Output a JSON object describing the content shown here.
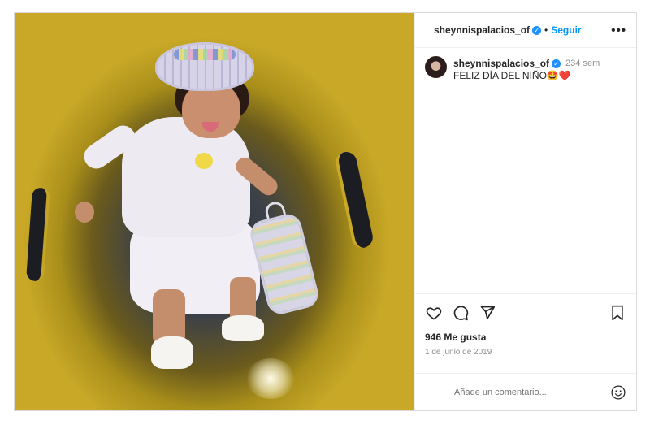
{
  "post": {
    "username": "sheynnispalacios_of",
    "follow_label": "Seguir",
    "dot_separator": "•",
    "more_label": "•••",
    "caption_username": "sheynnispalacios_of",
    "caption_age": "234 sem",
    "caption_text": "FELIZ DÍA DEL NIÑO🤩❤️",
    "likes": "946 Me gusta",
    "date": "1 de junio de 2019",
    "comment_placeholder": "Añade un comentario...",
    "verified_mark": "✓"
  },
  "colors": {
    "follow_blue": "#0095f6",
    "verified_blue": "#1e90ff",
    "muted_text": "#8e8e8e",
    "border": "#dbdbdb"
  },
  "icons": [
    "heart-icon",
    "comment-icon",
    "share-icon",
    "bookmark-icon",
    "emoji-icon",
    "more-options-icon",
    "verified-badge-icon"
  ]
}
